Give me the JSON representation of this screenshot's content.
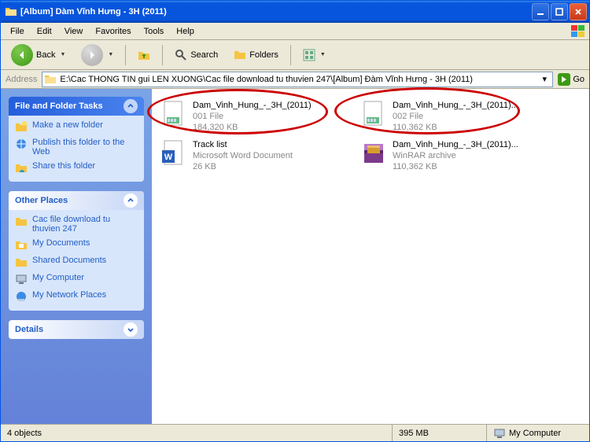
{
  "window": {
    "title": "[Album] Dàm Vĩnh Hưng - 3H (2011)"
  },
  "menubar": [
    "File",
    "Edit",
    "View",
    "Favorites",
    "Tools",
    "Help"
  ],
  "toolbar": {
    "back_label": "Back",
    "search_label": "Search",
    "folders_label": "Folders"
  },
  "addressbar": {
    "label": "Address",
    "path": "E:\\Cac THONG TIN gui LEN  XUONG\\Cac file download tu thuvien 247\\[Album] Đàm Vĩnh Hưng - 3H (2011)",
    "go_label": "Go"
  },
  "sidebar": {
    "panel1_title": "File and Folder Tasks",
    "panel1_items": [
      "Make a new folder",
      "Publish this folder to the Web",
      "Share this folder"
    ],
    "panel2_title": "Other Places",
    "panel2_items": [
      "Cac file download tu thuvien 247",
      "My Documents",
      "Shared Documents",
      "My Computer",
      "My Network Places"
    ],
    "panel3_title": "Details"
  },
  "files": [
    {
      "name": "Dam_Vinh_Hung_-_3H_(2011)",
      "line2": "001 File",
      "line3": "184,320 KB",
      "icon": "file"
    },
    {
      "name": "Dam_Vinh_Hung_-_3H_(2011)...",
      "line2": "002 File",
      "line3": "110,362 KB",
      "icon": "file"
    },
    {
      "name": "Track list",
      "line2": "Microsoft Word Document",
      "line3": "26 KB",
      "icon": "word"
    },
    {
      "name": "Dam_Vinh_Hung_-_3H_(2011)...",
      "line2": "WinRAR archive",
      "line3": "110,362 KB",
      "icon": "rar"
    }
  ],
  "statusbar": {
    "count": "4 objects",
    "size": "395 MB",
    "location": "My Computer"
  }
}
